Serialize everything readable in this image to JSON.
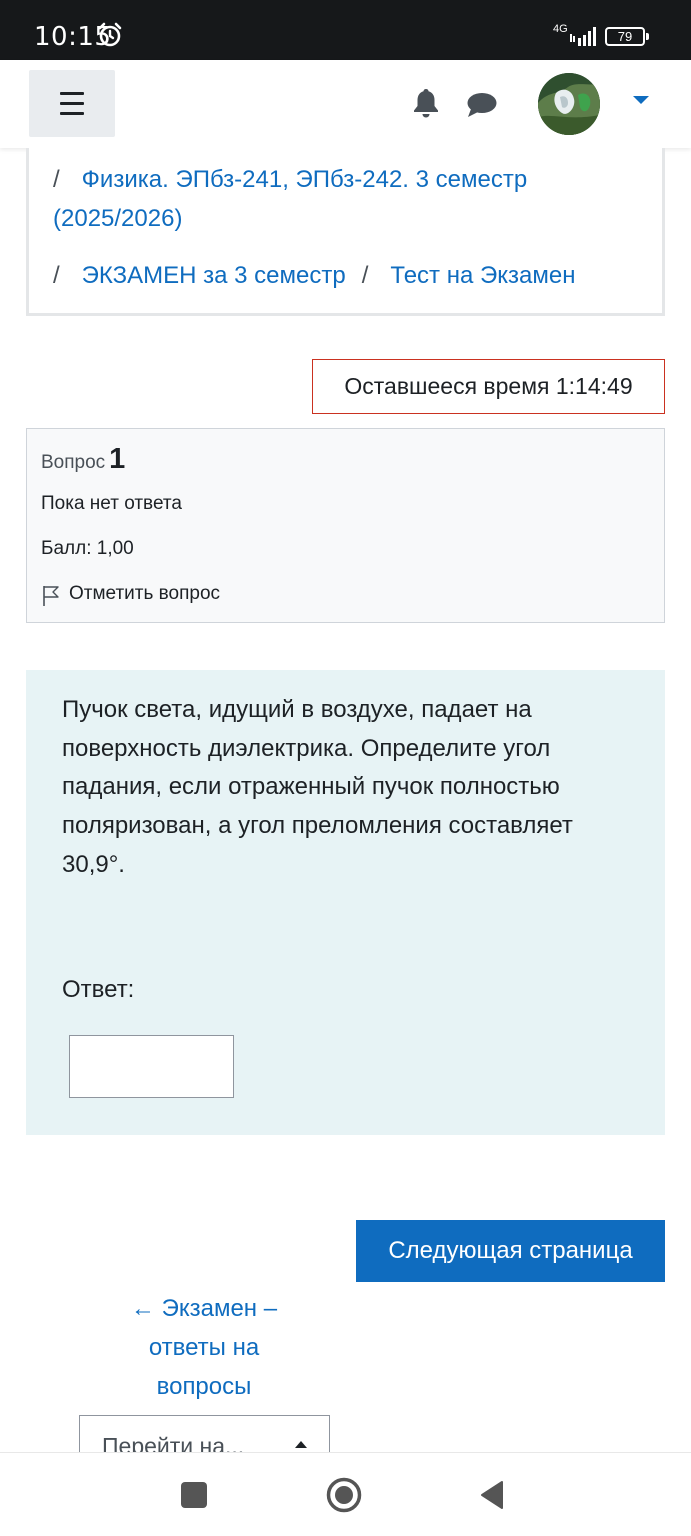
{
  "status_bar": {
    "time": "10:15",
    "network": "4G",
    "battery": "79"
  },
  "navbar": {
    "menu_icon": "hamburger-icon",
    "notifications_icon": "bell-icon",
    "messages_icon": "chat-icon",
    "user_menu_icon": "caret-down-icon"
  },
  "breadcrumb": {
    "separator": "/",
    "course": "Физика. ЭПбз-241, ЭПбз-242. 3 семестр (2025/2026)",
    "section": "ЭКЗАМЕН за 3 семестр",
    "quiz": "Тест на Экзамен"
  },
  "timer": {
    "text": "Оставшееся время 1:14:49"
  },
  "question_info": {
    "label": "Вопрос",
    "number": "1",
    "state": "Пока нет ответа",
    "grade": "Балл: 1,00",
    "flag_label": "Отметить вопрос"
  },
  "question": {
    "text": "Пучок света, идущий в воздухе, падает на поверхность диэлектрика. Определите угол падания, если отраженный пучок полностью поляризован, а угол преломления составляет 30,9°.",
    "answer_label": "Ответ:",
    "answer_value": ""
  },
  "navigation": {
    "next_button": "Следующая страница",
    "prev_activity": "← Экзамен – ответы на вопросы",
    "jump_select": "Перейти на..."
  },
  "colors": {
    "primary": "#0f6cbf",
    "timer_border": "#ca3120",
    "question_bg": "#e7f3f5",
    "info_bg": "#f8f9fa"
  }
}
